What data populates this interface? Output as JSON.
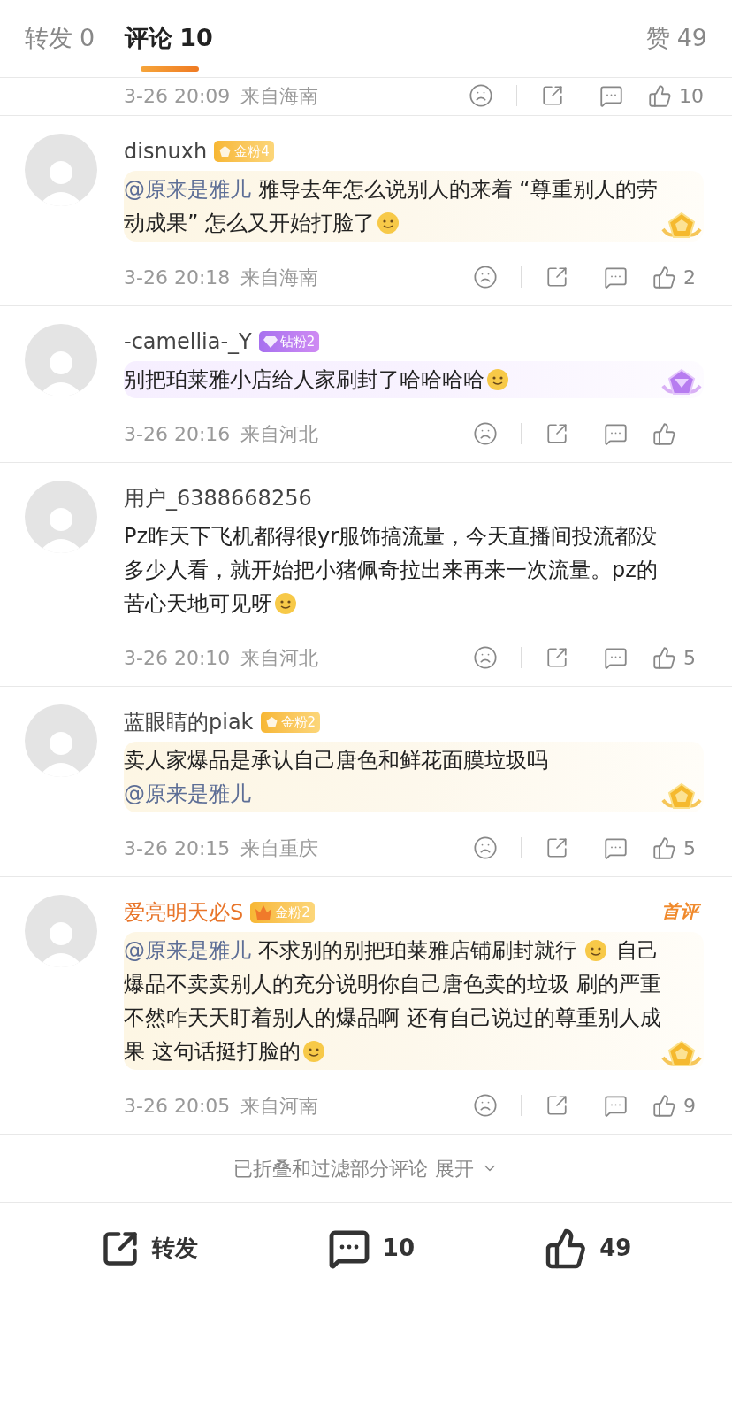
{
  "tabs": [
    {
      "label": "转发",
      "count": "0",
      "selected": false
    },
    {
      "label": "评论",
      "count": "10",
      "selected": true
    },
    {
      "label": "赞",
      "count": "49",
      "selected": false
    }
  ],
  "partial_meta": {
    "time": "3-26 20:09",
    "location": "来自海南",
    "likes": "10"
  },
  "comments": [
    {
      "name": "disnuxh",
      "vip": false,
      "badge": {
        "kind": "gold",
        "label": "金粉4"
      },
      "kind": "gold",
      "body": [
        {
          "kind": "mention",
          "text": "@原来是雅儿"
        },
        {
          "kind": "text",
          "text": " 雅导去年怎么说别人的来着 “尊重别人的劳动成果” 怎么又开始打脸了"
        },
        {
          "kind": "emoji"
        }
      ],
      "time": "3-26 20:18",
      "location": "来自海南",
      "likes": "2"
    },
    {
      "name": "-camellia-_Y",
      "vip": false,
      "badge": {
        "kind": "diamond",
        "label": "钻粉2"
      },
      "kind": "diamond",
      "body": [
        {
          "kind": "text",
          "text": "别把珀莱雅小店给人家刷封了哈哈哈哈"
        },
        {
          "kind": "emoji"
        }
      ],
      "time": "3-26 20:16",
      "location": "来自河北"
    },
    {
      "name": "用户_6388668256",
      "vip": false,
      "kind": "plain",
      "body": [
        {
          "kind": "text",
          "text": "Pz昨天下飞机都得很yr服饰搞流量，今天直播间投流都没多少人看，就开始把小猪佩奇拉出来再来一次流量。pz的苦心天地可见呀"
        },
        {
          "kind": "emoji"
        }
      ],
      "time": "3-26 20:10",
      "location": "来自河北",
      "likes": "5"
    },
    {
      "name": "蓝眼睛的piak",
      "vip": false,
      "badge": {
        "kind": "gold",
        "label": "金粉2"
      },
      "kind": "gold",
      "body": [
        {
          "kind": "text",
          "text": "卖人家爆品是承认自己唐色和鲜花面膜垃圾吗 "
        },
        {
          "kind": "mention",
          "text": "@原来是雅儿"
        }
      ],
      "time": "3-26 20:15",
      "location": "来自重庆",
      "likes": "5"
    },
    {
      "name": "爱亮明天必S",
      "vip": true,
      "badge": {
        "kind": "crown",
        "label": "金粉2"
      },
      "tag": "首评",
      "kind": "gold",
      "body": [
        {
          "kind": "mention",
          "text": "@原来是雅儿"
        },
        {
          "kind": "text",
          "text": " 不求别的别把珀莱雅店铺刷封就行 "
        },
        {
          "kind": "emoji"
        },
        {
          "kind": "text",
          "text": " 自己爆品不卖卖别人的充分说明你自己唐色卖的垃圾 刷的严重不然咋天天盯着别人的爆品啊 还有自己说过的尊重别人成果 这句话挺打脸的"
        },
        {
          "kind": "emoji"
        }
      ],
      "time": "3-26 20:05",
      "location": "来自河南",
      "likes": "9"
    }
  ],
  "collapsed": {
    "text": "已折叠和过滤部分评论",
    "action": "展开"
  },
  "bottom_bar": [
    {
      "kind": "repost",
      "label": "转发"
    },
    {
      "kind": "comment",
      "label": "10"
    },
    {
      "kind": "like",
      "label": "49"
    }
  ]
}
